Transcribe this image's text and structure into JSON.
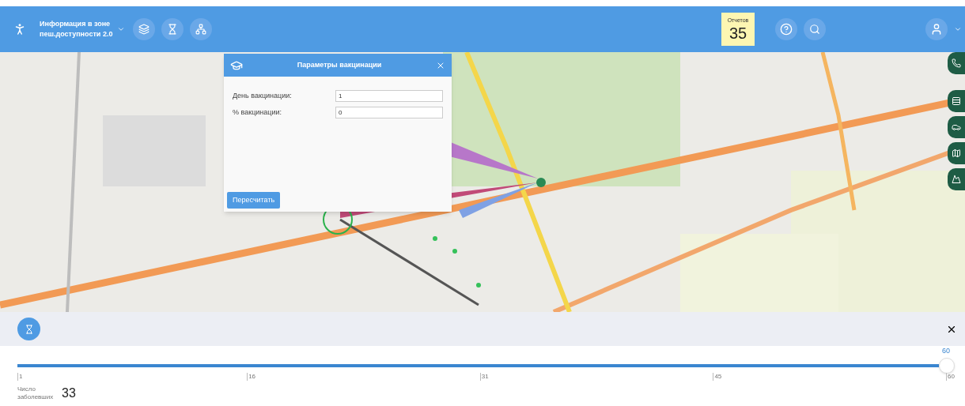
{
  "header": {
    "app_title": "Информация в зоне\nпеш.доступности 2.0",
    "reports": {
      "label": "Отчетов",
      "count": "35"
    }
  },
  "dialog": {
    "title": "Параметры вакцинации",
    "fields": [
      {
        "label": "День вакцинации:",
        "value": "1"
      },
      {
        "label": "% вакцинации:",
        "value": "0"
      }
    ],
    "button": "Пересчитать"
  },
  "timeline": {
    "slider": {
      "value_label": "60",
      "level": 1
    },
    "ticks": [
      "1",
      "16",
      "31",
      "45",
      "60"
    ],
    "stat": {
      "label": "Число заболевших",
      "value": "33"
    }
  }
}
